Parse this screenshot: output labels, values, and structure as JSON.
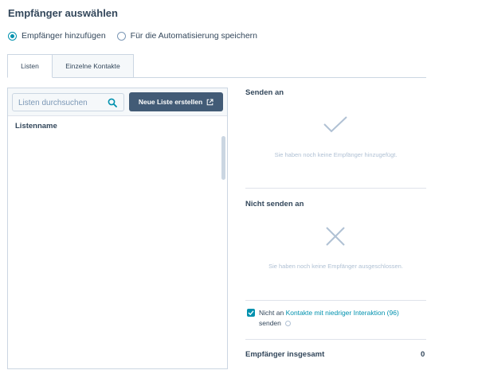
{
  "header": {
    "title": "Empfänger auswählen"
  },
  "mode": {
    "options": [
      {
        "label": "Empfänger hinzufügen",
        "selected": true
      },
      {
        "label": "Für die Automatisierung speichern",
        "selected": false
      }
    ]
  },
  "tabs": [
    {
      "label": "Listen",
      "active": true
    },
    {
      "label": "Einzelne Kontakte",
      "active": false
    }
  ],
  "list_panel": {
    "search_placeholder": "Listen durchsuchen",
    "new_list_label": "Neue Liste erstellen",
    "column_header": "Listenname"
  },
  "send_to": {
    "title": "Senden an",
    "empty_message": "Sie haben noch keine Empfänger hinzugefügt."
  },
  "do_not_send": {
    "title": "Nicht senden an",
    "empty_message": "Sie haben noch keine Empfänger ausgeschlossen."
  },
  "low_engagement": {
    "checked": true,
    "prefix": "Nicht an",
    "link_text": "Kontakte mit niedriger Interaktion (96)",
    "suffix": "senden"
  },
  "total": {
    "label": "Empfänger insgesamt",
    "value": "0"
  },
  "colors": {
    "accent": "#0091ae",
    "button": "#425b76",
    "text": "#33475b",
    "muted": "#b0c1d4"
  }
}
